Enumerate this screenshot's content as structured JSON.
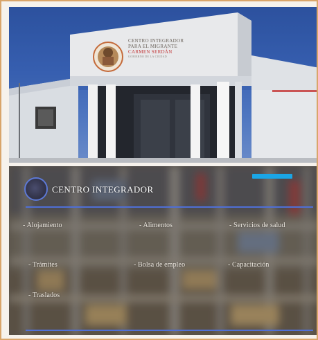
{
  "photo": {
    "sign_lines": [
      "Centro Integrador",
      "para el Migrante",
      "Carmen Serdán",
      "Gobierno de la Ciudad"
    ]
  },
  "panel": {
    "title": "CENTRO INTEGRADOR",
    "accent_color": "#1aa6e6",
    "rule_color": "#4f6fd6",
    "menu": [
      {
        "label": "- Alojamiento"
      },
      {
        "label": "- Alimentos"
      },
      {
        "label": "- Servicios de salud"
      },
      {
        "label": "- Trámites"
      },
      {
        "label": "- Bolsa de empleo"
      },
      {
        "label": "- Capacitación"
      },
      {
        "label": "- Traslados"
      }
    ]
  }
}
